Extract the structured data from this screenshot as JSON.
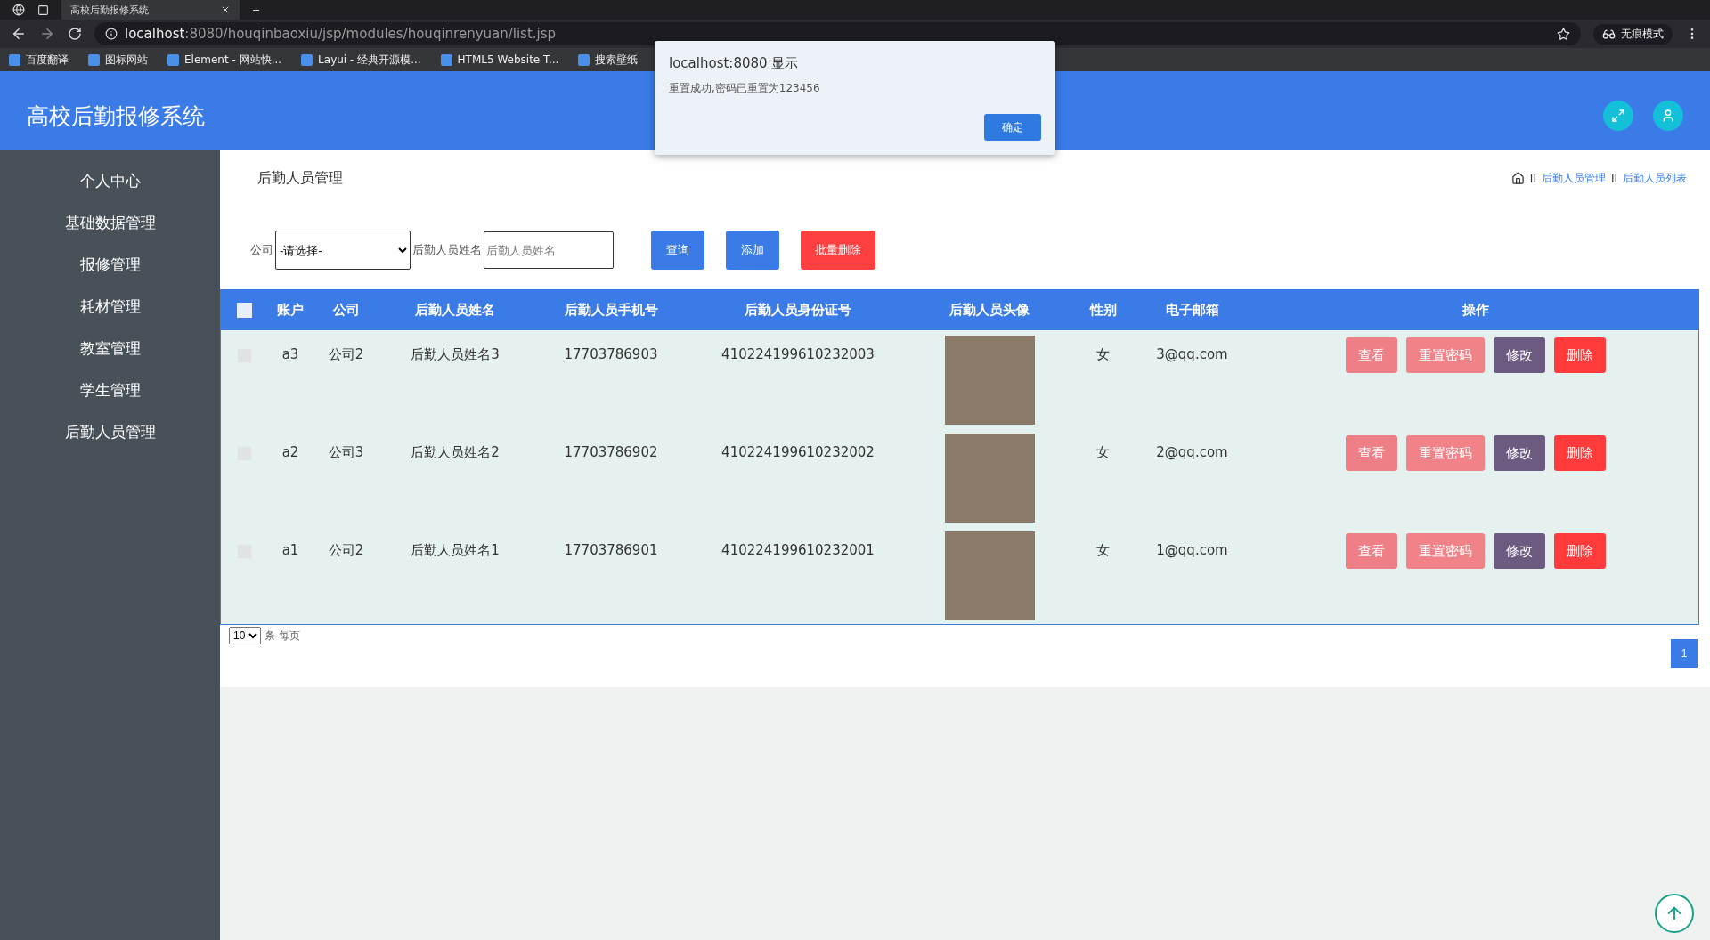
{
  "browser": {
    "tab_title": "高校后勤报修系统",
    "new_tab": "+",
    "url_host": "localhost",
    "url_rest": ":8080/houqinbaoxiu/jsp/modules/houqinrenyuan/list.jsp",
    "profile": "无痕模式",
    "bookmarks": [
      "百度翻译",
      "图标网站",
      "Element - 网站快...",
      "Layui - 经典开源模...",
      "HTML5 Website T...",
      "搜索壁纸"
    ]
  },
  "dialog": {
    "title": "localhost:8080 显示",
    "message": "重置成功,密码已重置为123456",
    "button": "确定"
  },
  "header": {
    "title": "高校后勤报修系统"
  },
  "sidebar": {
    "items": [
      {
        "label": "个人中心"
      },
      {
        "label": "基础数据管理"
      },
      {
        "label": "报修管理"
      },
      {
        "label": "耗材管理"
      },
      {
        "label": "教室管理"
      },
      {
        "label": "学生管理"
      },
      {
        "label": "后勤人员管理"
      }
    ]
  },
  "page": {
    "title": "后勤人员管理",
    "breadcrumb": [
      {
        "separator": "II",
        "label": "后勤人员管理"
      },
      {
        "separator": "II",
        "label": "后勤人员列表"
      }
    ]
  },
  "search": {
    "fields": [
      {
        "kind": "select",
        "label": "公司",
        "value": "-请选择-"
      },
      {
        "kind": "input",
        "label": "后勤人员姓名",
        "placeholder": "后勤人员姓名"
      }
    ],
    "buttons": [
      {
        "kind": "primary",
        "label": "查询"
      },
      {
        "kind": "primary",
        "label": "添加"
      },
      {
        "kind": "danger",
        "label": "批量删除"
      }
    ]
  },
  "table": {
    "select_all_checked": false,
    "columns": [
      "账户",
      "公司",
      "后勤人员姓名",
      "后勤人员手机号",
      "后勤人员身份证号",
      "后勤人员头像",
      "性别",
      "电子邮箱",
      "操作"
    ],
    "rows": [
      {
        "checked": false,
        "cells": [
          "a3",
          "公司2",
          "后勤人员姓名3",
          "17703786903",
          "410224199610232003"
        ],
        "gender": "女",
        "email": "3@qq.com",
        "actions": [
          {
            "kind": "view",
            "label": "查看"
          },
          {
            "kind": "reset",
            "label": "重置密码"
          },
          {
            "kind": "edit",
            "label": "修改"
          },
          {
            "kind": "delete",
            "label": "删除"
          }
        ]
      },
      {
        "checked": false,
        "cells": [
          "a2",
          "公司3",
          "后勤人员姓名2",
          "17703786902",
          "410224199610232002"
        ],
        "gender": "女",
        "email": "2@qq.com",
        "actions": [
          {
            "kind": "view",
            "label": "查看"
          },
          {
            "kind": "reset",
            "label": "重置密码"
          },
          {
            "kind": "edit",
            "label": "修改"
          },
          {
            "kind": "delete",
            "label": "删除"
          }
        ]
      },
      {
        "checked": false,
        "cells": [
          "a1",
          "公司2",
          "后勤人员姓名1",
          "17703786901",
          "410224199610232001"
        ],
        "gender": "女",
        "email": "1@qq.com",
        "actions": [
          {
            "kind": "view",
            "label": "查看"
          },
          {
            "kind": "reset",
            "label": "重置密码"
          },
          {
            "kind": "edit",
            "label": "修改"
          },
          {
            "kind": "delete",
            "label": "删除"
          }
        ]
      }
    ]
  },
  "pagination": {
    "page_size": "10",
    "page_size_label": "条 每页",
    "pages": [
      {
        "label": "1",
        "selected": true
      }
    ]
  }
}
